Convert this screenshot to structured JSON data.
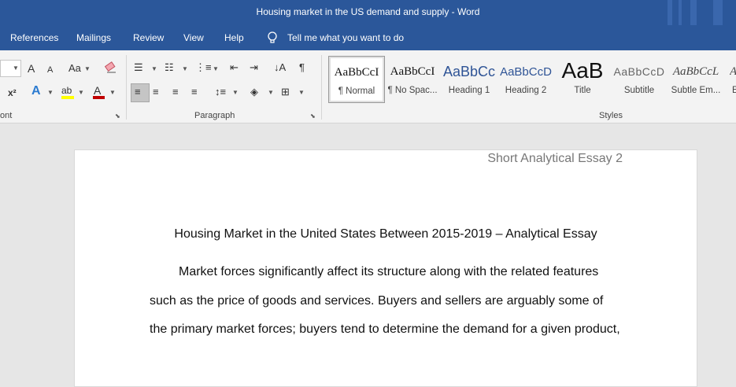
{
  "titlebar": {
    "title": "Housing market in the US demand and supply  -  Word"
  },
  "menu": {
    "items": [
      "References",
      "Mailings",
      "Review",
      "View",
      "Help"
    ],
    "tell_me": "Tell me what you want to do"
  },
  "ribbon": {
    "groups": {
      "font": "ont",
      "paragraph": "Paragraph",
      "styles": "Styles"
    },
    "font_size_grow": "A",
    "font_size_shrink": "A",
    "change_case": "Aa",
    "superscript": "x²",
    "styles": [
      {
        "sample": "AaBbCcI",
        "name": "¶ Normal"
      },
      {
        "sample": "AaBbCcI",
        "name": "¶ No Spac..."
      },
      {
        "sample": "AaBbCc",
        "name": "Heading 1"
      },
      {
        "sample": "AaBbCcD",
        "name": "Heading 2"
      },
      {
        "sample": "AaB",
        "name": "Title"
      },
      {
        "sample": "AaBbCcD",
        "name": "Subtitle"
      },
      {
        "sample": "AaBbCcL",
        "name": "Subtle Em..."
      },
      {
        "sample": "A",
        "name": "E"
      }
    ],
    "colors": {
      "highlight": "#ffff00",
      "font_color": "#c00000",
      "accent": "#2b579a"
    }
  },
  "document": {
    "header": "Short Analytical Essay 2",
    "title": "Housing Market in the United States Between 2015-2019 – Analytical Essay",
    "lines": [
      "Market forces significantly affect its structure along with the related features",
      "such as the price of goods and services. Buyers and sellers are arguably some of",
      "the primary market forces; buyers tend to determine the demand for a given product,"
    ]
  }
}
